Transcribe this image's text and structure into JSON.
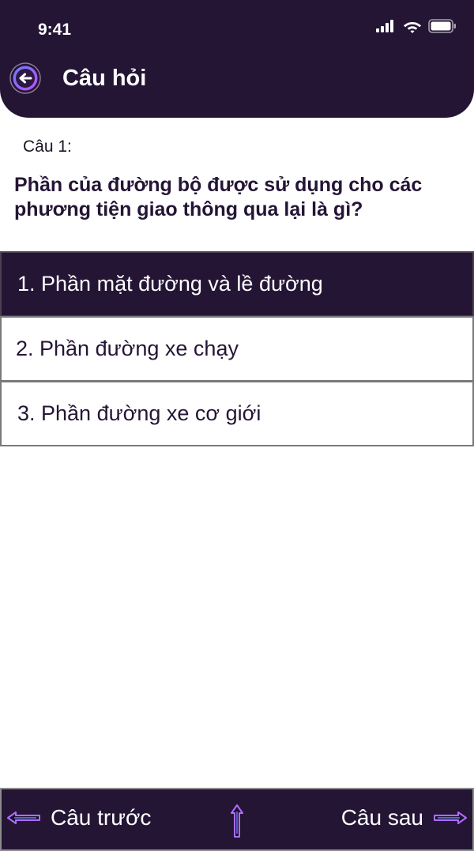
{
  "status_bar": {
    "time": "9:41",
    "icons": [
      "cellular-signal-icon",
      "wifi-icon",
      "battery-icon"
    ]
  },
  "header": {
    "title": "Câu hỏi",
    "back_icon": "arrow-left-circle-icon"
  },
  "question": {
    "number_label": "Câu 1:",
    "text": "Phần của đường bộ được sử dụng cho các phương tiện giao thông qua lại là gì?"
  },
  "answers": [
    {
      "label": "1. Phần mặt đường và lề đường",
      "selected": true
    },
    {
      "label": "2. Phần đường xe chạy",
      "selected": false
    },
    {
      "label": "3. Phần đường xe cơ giới",
      "selected": false
    }
  ],
  "footer": {
    "prev_label": "Câu trước",
    "next_label": "Câu sau",
    "prev_icon": "arrow-left-icon",
    "up_icon": "arrow-up-icon",
    "next_icon": "arrow-right-icon"
  },
  "colors": {
    "primary": "#241535",
    "accent_purple": "#a259ff",
    "accent_blue": "#5b7cff",
    "border": "#7a7a7a"
  }
}
